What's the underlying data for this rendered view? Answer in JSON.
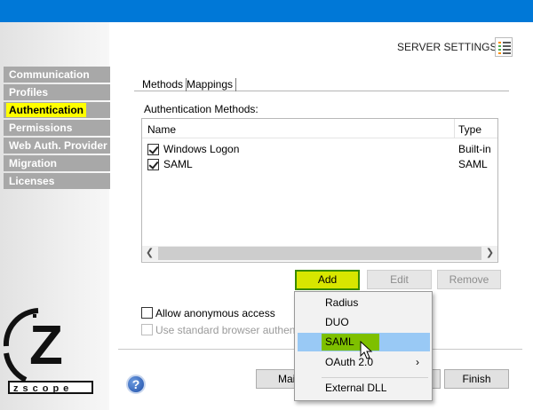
{
  "header": {
    "server_settings_label": "SERVER SETTINGS"
  },
  "nav": {
    "items": [
      {
        "label": "Communication"
      },
      {
        "label": "Profiles"
      },
      {
        "label": "Authentication"
      },
      {
        "label": "Permissions"
      },
      {
        "label": "Web Auth. Provider"
      },
      {
        "label": "Migration"
      },
      {
        "label": "Licenses"
      }
    ],
    "active": "Authentication"
  },
  "tabs": [
    {
      "label": "Methods"
    },
    {
      "label": "Mappings"
    }
  ],
  "auth": {
    "section_label": "Authentication Methods:",
    "columns": {
      "name": "Name",
      "type": "Type"
    },
    "rows": [
      {
        "name": "Windows Logon",
        "type": "Built-in",
        "checked": true
      },
      {
        "name": "SAML",
        "type": "SAML",
        "checked": true
      }
    ],
    "buttons": {
      "add": "Add",
      "edit": "Edit",
      "remove": "Remove"
    }
  },
  "options": {
    "allow_anonymous": "Allow anonymous access",
    "standard_browser": "Use standard browser authentica"
  },
  "footer": {
    "main_partial": "Mai",
    "finish": "Finish",
    "help_glyph": "?"
  },
  "logo": {
    "letter": "Z",
    "wordmark": "zscope"
  },
  "add_menu": {
    "items": [
      {
        "label": "Radius"
      },
      {
        "label": "DUO"
      },
      {
        "label": "SAML"
      },
      {
        "label": "OAuth 2.0",
        "submenu": "›"
      },
      {
        "label": "External DLL"
      }
    ],
    "highlighted": "SAML"
  },
  "colors": {
    "titlebar": "#0078d7",
    "nav_bg": "#a8a8a8",
    "active_highlight": "#ffff00",
    "add_button": "#d8e600",
    "menu_hover": "#99c9f5",
    "menu_hover_label": "#7ec000"
  }
}
